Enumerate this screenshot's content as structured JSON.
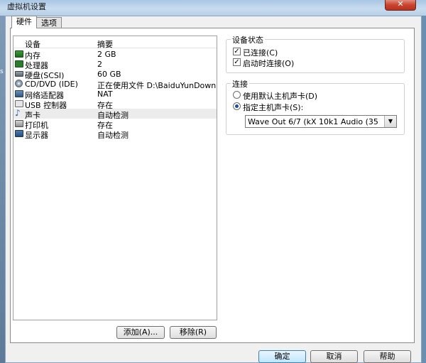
{
  "window": {
    "title": "虚拟机设置",
    "close_glyph": "✕"
  },
  "left_strip_text": "s",
  "tabs": [
    {
      "label": "硬件",
      "active": true
    },
    {
      "label": "选项",
      "active": false
    }
  ],
  "device_list": {
    "headers": {
      "device": "设备",
      "summary": "摘要"
    },
    "rows": [
      {
        "icon": "memory-icon",
        "device": "内存",
        "summary": "2 GB"
      },
      {
        "icon": "processor-icon",
        "device": "处理器",
        "summary": "2"
      },
      {
        "icon": "hard-disk-icon",
        "device": "硬盘(SCSI)",
        "summary": "60 GB"
      },
      {
        "icon": "cd-dvd-icon",
        "device": "CD/DVD (IDE)",
        "summary": "正在使用文件 D:\\BaiduYunDownloa..."
      },
      {
        "icon": "network-adapter-icon",
        "device": "网络适配器",
        "summary": "NAT"
      },
      {
        "icon": "usb-icon",
        "device": "USB 控制器",
        "summary": "存在"
      },
      {
        "icon": "sound-card-icon",
        "device": "声卡",
        "summary": "自动检测",
        "selected": true
      },
      {
        "icon": "printer-icon",
        "device": "打印机",
        "summary": "存在"
      },
      {
        "icon": "display-icon",
        "device": "显示器",
        "summary": "自动检测"
      }
    ]
  },
  "device_status": {
    "title": "设备状态",
    "connected": {
      "label": "已连接(C)",
      "checked": true
    },
    "connect_at_power_on": {
      "label": "启动时连接(O)",
      "checked": true
    }
  },
  "connection": {
    "title": "连接",
    "use_default": {
      "label": "使用默认主机声卡(D)",
      "selected": false
    },
    "specify": {
      "label": "指定主机声卡(S):",
      "selected": true
    },
    "selected_card": "Wave Out 6/7 (kX 10k1 Audio (35"
  },
  "buttons": {
    "add": "添加(A)...",
    "remove": "移除(R)",
    "ok": "确定",
    "cancel": "取消",
    "help": "帮助"
  },
  "glyphs": {
    "check": "✓",
    "dropdown": "▼",
    "speaker": "♪"
  }
}
